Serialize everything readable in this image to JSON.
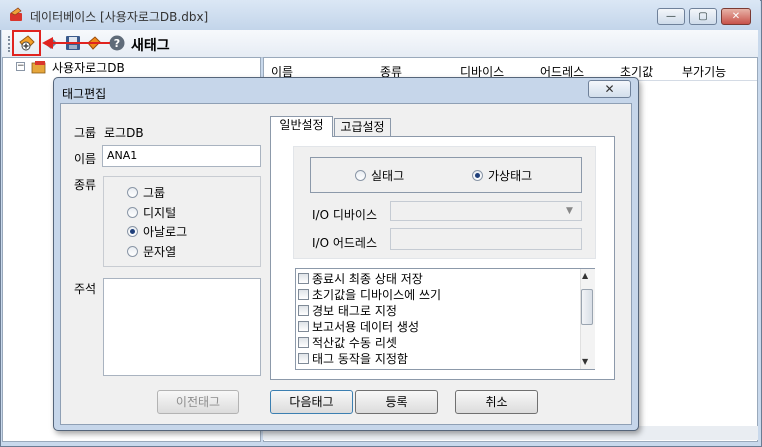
{
  "window": {
    "title": "데이터베이스 [사용자로그DB.dbx]",
    "controls": {
      "minimize": "—",
      "maximize": "▢",
      "close": "✕"
    }
  },
  "toolbar": {
    "new_tag_label": "새태그",
    "icons": [
      "new-tag-icon",
      "tag-list-icon",
      "save-icon",
      "tag-sync-icon",
      "help-icon"
    ]
  },
  "tree": {
    "root_label": "사용자로그DB",
    "expander": "−"
  },
  "list": {
    "columns": [
      "이름",
      "종류",
      "디바이스",
      "어드레스",
      "초기값",
      "부가기능"
    ]
  },
  "dialog": {
    "title": "태그편집",
    "close": "✕",
    "group_label": "그룹",
    "group_value": "로그DB",
    "name_label": "이름",
    "name_value": "ANA1",
    "kind_label": "종류",
    "kinds": [
      {
        "label": "그룹",
        "selected": false
      },
      {
        "label": "디지털",
        "selected": false
      },
      {
        "label": "아날로그",
        "selected": true
      },
      {
        "label": "문자열",
        "selected": false
      }
    ],
    "memo_label": "주석",
    "tabs": [
      "일반설정",
      "고급설정"
    ],
    "tag_types": [
      {
        "label": "실태그",
        "selected": false
      },
      {
        "label": "가상태그",
        "selected": true
      }
    ],
    "io_device_label": "I/O 디바이스",
    "io_address_label": "I/O 어드레스",
    "options": [
      "종료시 최종 상태 저장",
      "초기값을 디바이스에 쓰기",
      "경보 태그로 지정",
      "보고서용 데이터 생성",
      "적산값 수동 리셋",
      "태그 동작을 지정함"
    ],
    "buttons": {
      "prev": "이전태그",
      "next": "다음태그",
      "register": "등록",
      "cancel": "취소"
    }
  },
  "colors": {
    "accent_red": "#e0231f",
    "window_bg": "#c9d9ec",
    "dialog_bg": "#f0f0f0"
  }
}
